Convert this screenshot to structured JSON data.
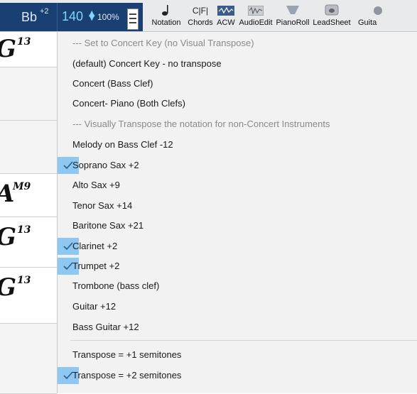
{
  "toolbar": {
    "key": "Bb",
    "key_transpose": "+2",
    "tempo": "140",
    "zoom": "100%",
    "buttons": [
      {
        "label": "Notation",
        "icon": "notation-icon"
      },
      {
        "label": "Chords",
        "icon": "chords-icon",
        "glyph": "C|F|"
      },
      {
        "label": "ACW",
        "icon": "acw-icon"
      },
      {
        "label": "AudioEdit",
        "icon": "audio-edit-icon"
      },
      {
        "label": "PianoRoll",
        "icon": "piano-roll-icon"
      },
      {
        "label": "LeadSheet",
        "icon": "lead-sheet-icon"
      },
      {
        "label": "Guita",
        "icon": "guitar-icon"
      }
    ]
  },
  "chord_strip": [
    {
      "root": "G",
      "ext": "13"
    },
    {
      "root": "A",
      "ext": "M9"
    },
    {
      "root": "G",
      "ext": "13"
    },
    {
      "root": "G",
      "ext": "13"
    }
  ],
  "menu": {
    "items": [
      {
        "label": "--- Set to Concert Key (no Visual Transpose)",
        "header": true,
        "checked": false
      },
      {
        "label": "(default) Concert Key - no transpose",
        "header": false,
        "checked": false
      },
      {
        "label": "Concert (Bass Clef)",
        "header": false,
        "checked": false
      },
      {
        "label": "Concert- Piano (Both Clefs)",
        "header": false,
        "checked": false
      },
      {
        "label": "--- Visually Transpose the notation for non-Concert Instruments",
        "header": true,
        "checked": false
      },
      {
        "label": "Melody on Bass Clef -12",
        "header": false,
        "checked": false
      },
      {
        "label": "Soprano Sax +2",
        "header": false,
        "checked": true
      },
      {
        "label": "Alto Sax +9",
        "header": false,
        "checked": false
      },
      {
        "label": "Tenor Sax +14",
        "header": false,
        "checked": false
      },
      {
        "label": "Baritone Sax +21",
        "header": false,
        "checked": false
      },
      {
        "label": "Clarinet +2",
        "header": false,
        "checked": true
      },
      {
        "label": "Trumpet +2",
        "header": false,
        "checked": true
      },
      {
        "label": "Trombone (bass clef)",
        "header": false,
        "checked": false
      },
      {
        "label": "Guitar +12",
        "header": false,
        "checked": false
      },
      {
        "label": "Bass Guitar +12",
        "header": false,
        "checked": false
      },
      {
        "label": "Transpose = +1 semitones",
        "header": false,
        "checked": false
      },
      {
        "label": "Transpose = +2 semitones",
        "header": false,
        "checked": true
      }
    ]
  },
  "colors": {
    "toolbar_dark": "#1a3f73",
    "tempo_text": "#7fd6ff",
    "check_highlight": "#8ec8f2",
    "menu_bg": "#f2f2f2",
    "header_text": "#8a8a8a"
  }
}
